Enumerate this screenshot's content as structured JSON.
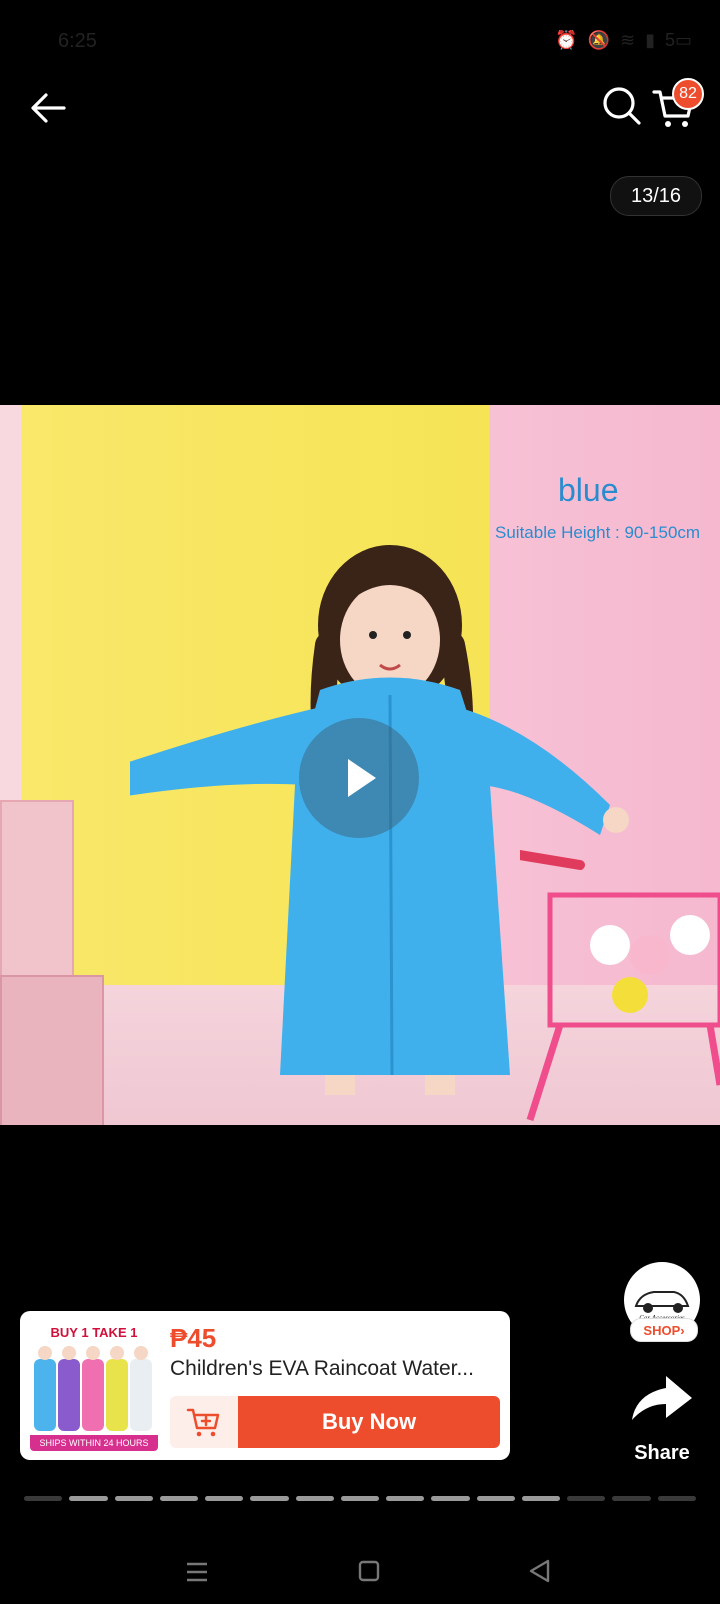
{
  "status_bar": {
    "time": "6:25",
    "battery": "5"
  },
  "nav": {
    "cart_count": "82"
  },
  "gallery": {
    "counter": "13/16",
    "color_label": "blue",
    "height_label": "Suitable Height : 90-150cm"
  },
  "shop": {
    "logo_text": "Car Accessories",
    "tag": "SHOP"
  },
  "share": {
    "label": "Share"
  },
  "product": {
    "thumb_title": "BUY 1 TAKE 1",
    "thumb_footer": "SHIPS WITHIN 24 HOURS",
    "price": "₱45",
    "title": "Children's EVA Raincoat Water...",
    "buy_now_label": "Buy Now"
  },
  "story_progress": {
    "total": 15,
    "done": 12
  },
  "colors": {
    "accent": "#ee4d2d",
    "text_overlay": "#2a8ccf"
  }
}
